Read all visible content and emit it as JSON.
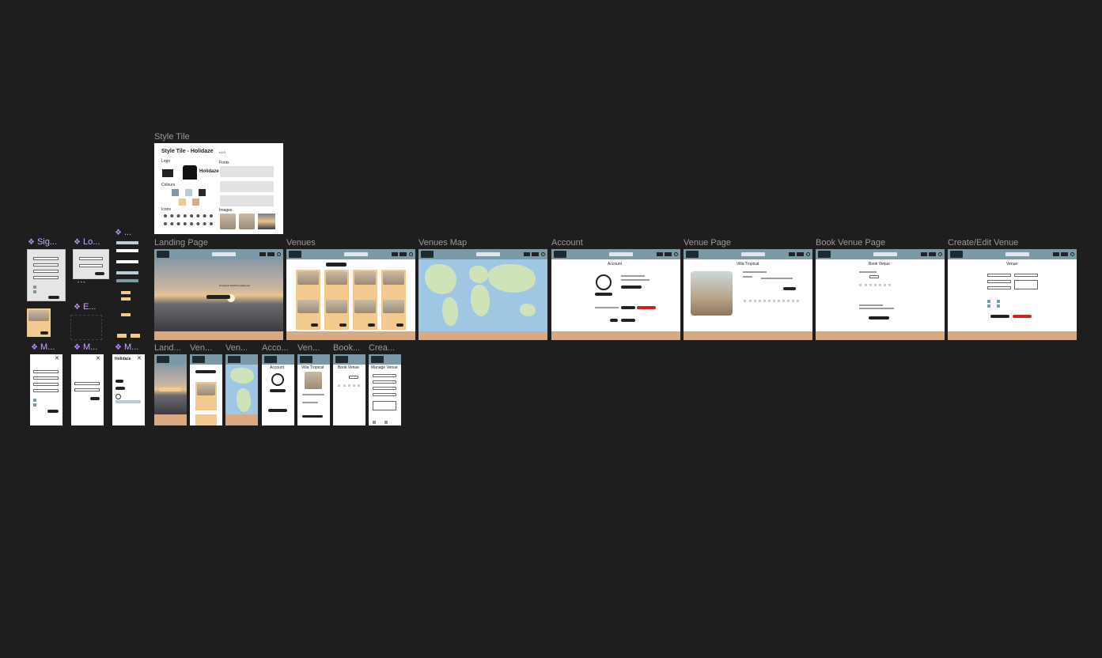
{
  "canvas": {
    "background": "#1e1e1e"
  },
  "style_tile": {
    "label": "Style Tile",
    "title": "Style Tile - Holidaze",
    "version": "v1.0",
    "logo_heading": "Logo",
    "brand_name": "Holidaze",
    "fonts_heading": "Fonts",
    "colours_heading": "Colours",
    "icons_heading": "Icons",
    "images_heading": "Images",
    "colours": [
      "#7c99a8",
      "#b8cdd8",
      "#2b2b2b",
      "#f2c98e",
      "#d9a982"
    ]
  },
  "component_labels": [
    "Sig...",
    "Lo...",
    "...",
    "E...",
    "M...",
    "M...",
    "M..."
  ],
  "desktop_frames": [
    {
      "label": "Landing Page",
      "hero_text": "Gorgeous beaches await you",
      "cta": "Browse venues"
    },
    {
      "label": "Venues"
    },
    {
      "label": "Venues Map"
    },
    {
      "label": "Account",
      "heading": "Account"
    },
    {
      "label": "Venue Page",
      "heading": "Villa Tropical"
    },
    {
      "label": "Book Venue Page",
      "heading": "Book Venue"
    },
    {
      "label": "Create/Edit Venue",
      "heading": "Venue"
    }
  ],
  "mobile_frames": [
    {
      "label": "Land..."
    },
    {
      "label": "Ven..."
    },
    {
      "label": "Ven..."
    },
    {
      "label": "Acco...",
      "heading": "Account"
    },
    {
      "label": "Ven...",
      "heading": "Villa Tropical"
    },
    {
      "label": "Book...",
      "heading": "Book Venue"
    },
    {
      "label": "Crea...",
      "heading": "Manage Venue"
    }
  ],
  "modal_brand": "Holidaze"
}
